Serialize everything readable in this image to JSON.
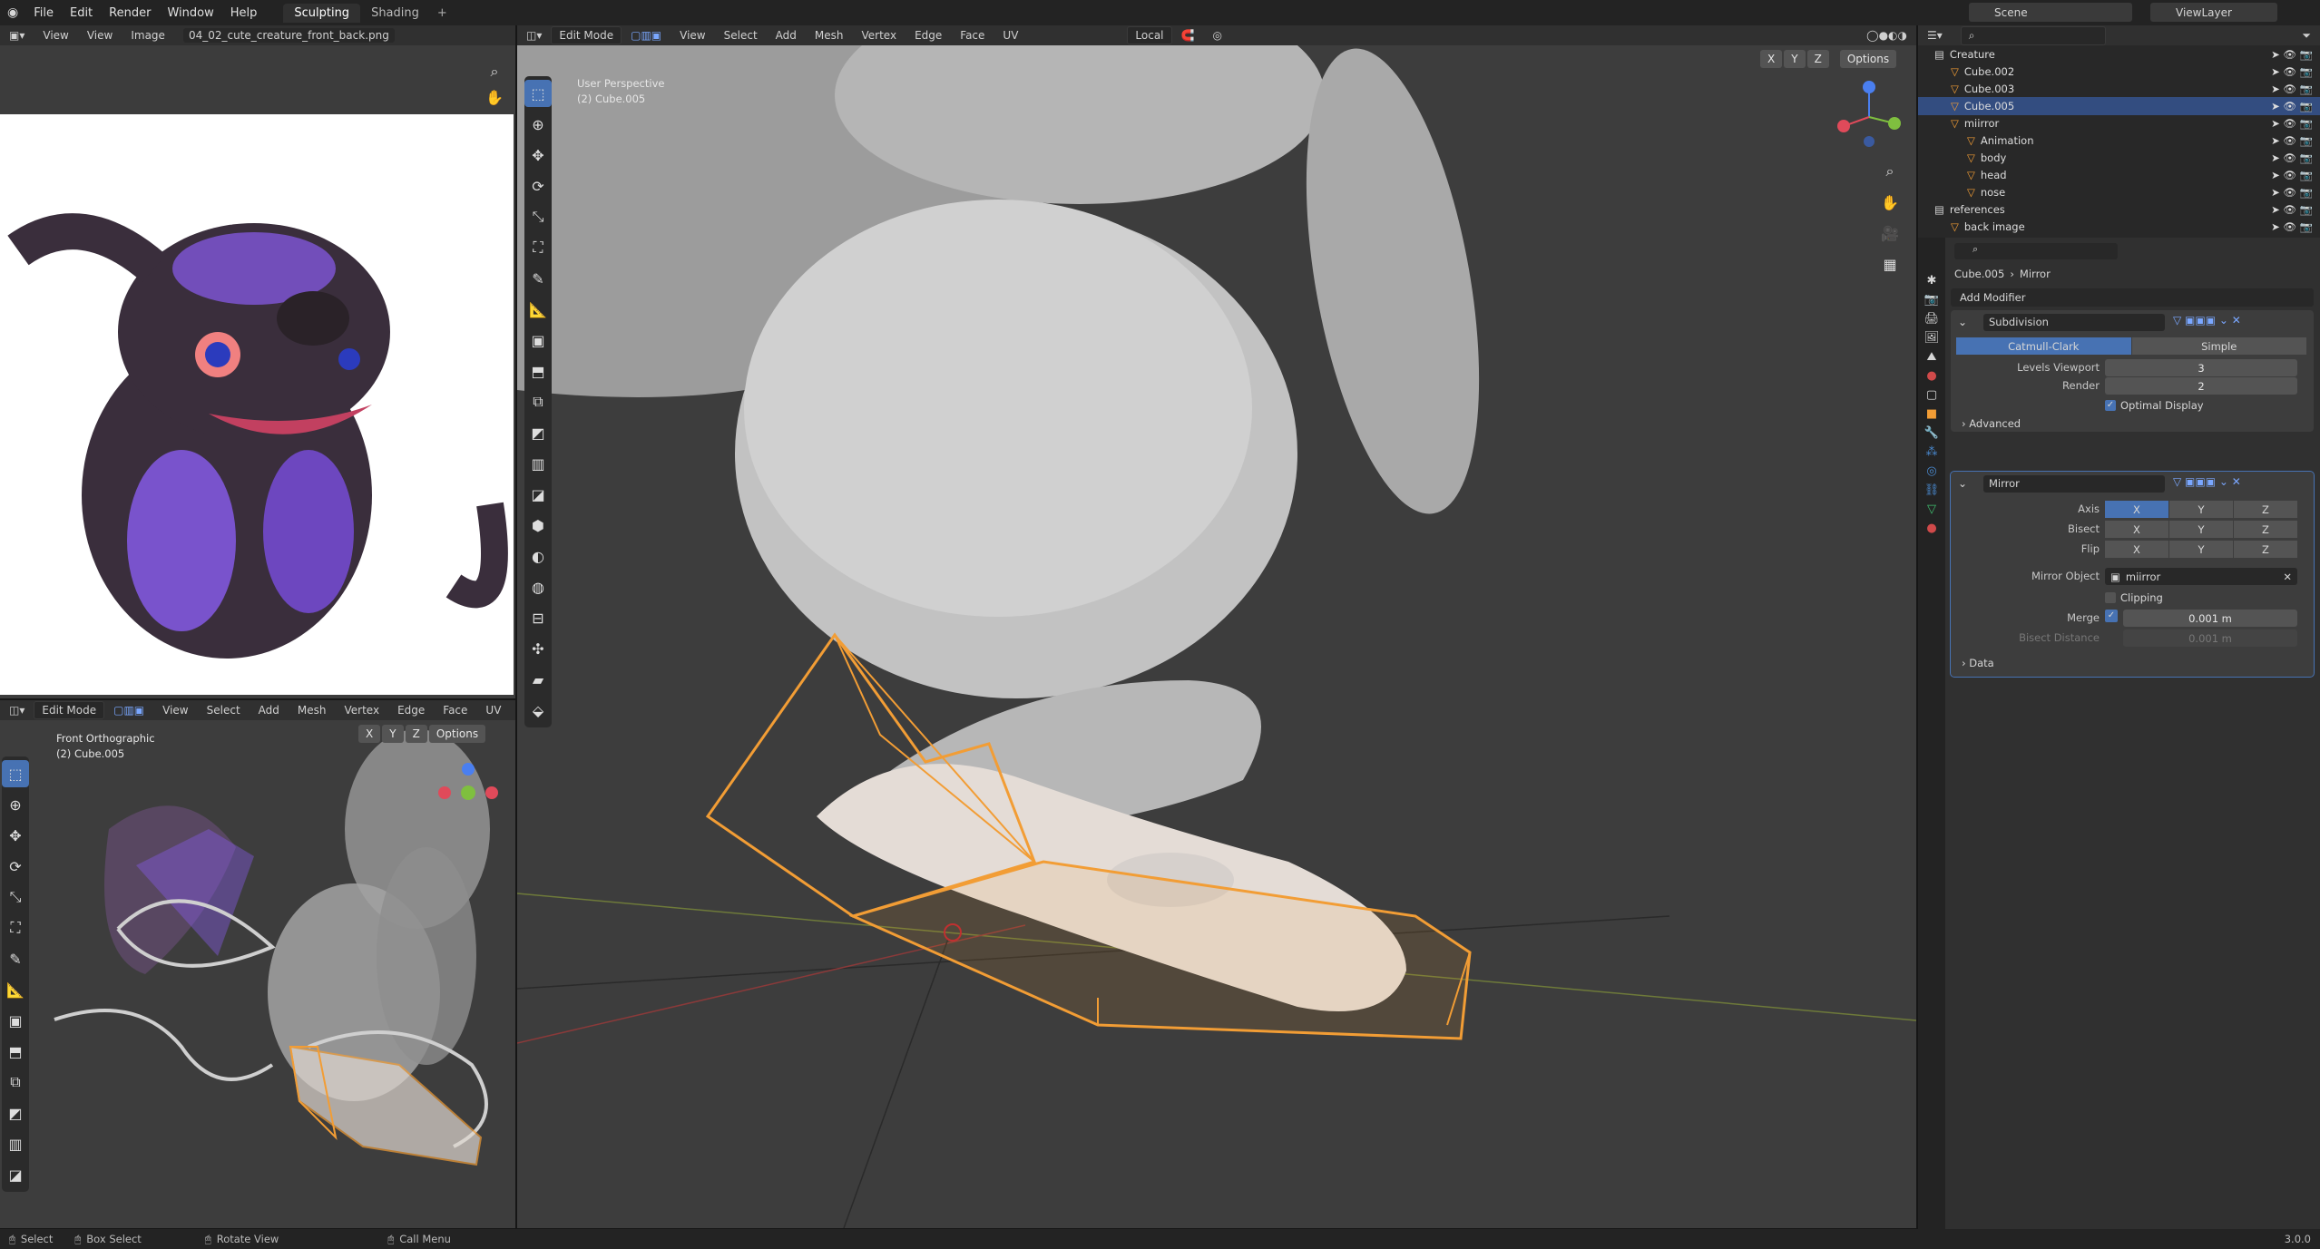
{
  "topbar": {
    "menus": [
      "File",
      "Edit",
      "Render",
      "Window",
      "Help"
    ],
    "workspaces": [
      "Sculpting",
      "Shading"
    ],
    "scene": "Scene",
    "view_layer": "ViewLayer"
  },
  "image_editor": {
    "menu": [
      "View",
      "View",
      "Image"
    ],
    "filename": "04_02_cute_creature_front_back.png"
  },
  "front_view": {
    "mode": "Edit Mode",
    "menus": [
      "View",
      "Select",
      "Add",
      "Mesh",
      "Vertex",
      "Edge",
      "Face",
      "UV"
    ],
    "options": "Options",
    "xyz": [
      "X",
      "Y",
      "Z"
    ],
    "overlay_line1": "Front Orthographic",
    "overlay_line2": "(2) Cube.005"
  },
  "main_view": {
    "mode": "Edit Mode",
    "menus": [
      "View",
      "Select",
      "Add",
      "Mesh",
      "Vertex",
      "Edge",
      "Face",
      "UV"
    ],
    "orientation": "Local",
    "options": "Options",
    "xyz": [
      "X",
      "Y",
      "Z"
    ],
    "overlay_line1": "User Perspective",
    "overlay_line2": "(2) Cube.005"
  },
  "outliner": {
    "rows": [
      {
        "label": "Creature",
        "indent": 1
      },
      {
        "label": "Cube.002",
        "indent": 2
      },
      {
        "label": "Cube.003",
        "indent": 2
      },
      {
        "label": "Cube.005",
        "indent": 2,
        "selected": true
      },
      {
        "label": "miirror",
        "indent": 2
      },
      {
        "label": "Animation",
        "indent": 3
      },
      {
        "label": "body",
        "indent": 3
      },
      {
        "label": "head",
        "indent": 3
      },
      {
        "label": "nose",
        "indent": 3
      },
      {
        "label": "references",
        "indent": 1
      },
      {
        "label": "back image",
        "indent": 2
      }
    ]
  },
  "properties": {
    "breadcrumb_object": "Cube.005",
    "breadcrumb_modifier": "Mirror",
    "add_modifier": "Add Modifier",
    "subdivision": {
      "name": "Subdivision",
      "mode_a": "Catmull-Clark",
      "mode_b": "Simple",
      "levels_label": "Levels Viewport",
      "levels_value": "3",
      "render_label": "Render",
      "render_value": "2",
      "optimal": "Optimal Display",
      "advanced": "Advanced"
    },
    "mirror": {
      "name": "Mirror",
      "axis_label": "Axis",
      "bisect_label": "Bisect",
      "flip_label": "Flip",
      "xyz": [
        "X",
        "Y",
        "Z"
      ],
      "mirror_object_label": "Mirror Object",
      "mirror_object": "miirror",
      "clipping": "Clipping",
      "merge_label": "Merge",
      "merge_value": "0.001 m",
      "bisect_distance_label": "Bisect Distance",
      "bisect_distance_value": "0.001 m",
      "data": "Data"
    }
  },
  "statusbar": {
    "select": "Select",
    "box_select": "Box Select",
    "rotate_view": "Rotate View",
    "call_menu": "Call Menu",
    "version": "3.0.0"
  },
  "colors": {
    "accent": "#4772b3",
    "selection": "#f29d35",
    "creature_purple": "#8a5cf0"
  }
}
